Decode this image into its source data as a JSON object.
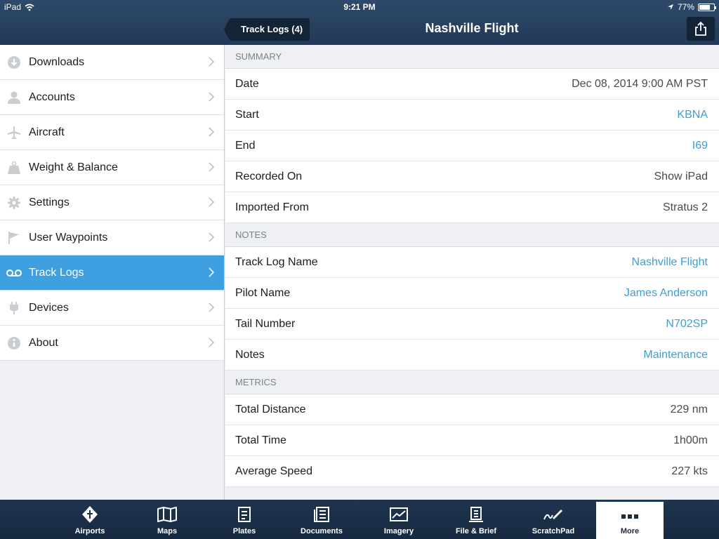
{
  "status": {
    "carrier": "iPad",
    "time": "9:21 PM",
    "battery": "77%",
    "battery_level": 0.77
  },
  "header": {
    "back_label": "Track Logs (4)",
    "title": "Nashville Flight"
  },
  "sidebar": {
    "items": [
      {
        "label": "Downloads",
        "icon": "download-icon"
      },
      {
        "label": "Accounts",
        "icon": "person-icon"
      },
      {
        "label": "Aircraft",
        "icon": "plane-icon"
      },
      {
        "label": "Weight & Balance",
        "icon": "weight-icon"
      },
      {
        "label": "Settings",
        "icon": "gear-icon"
      },
      {
        "label": "User Waypoints",
        "icon": "flag-icon"
      },
      {
        "label": "Track Logs",
        "icon": "voicemail-icon",
        "active": true
      },
      {
        "label": "Devices",
        "icon": "plug-icon"
      },
      {
        "label": "About",
        "icon": "info-icon"
      }
    ]
  },
  "summary": {
    "header": "SUMMARY",
    "rows": [
      {
        "label": "Date",
        "value": "Dec 08, 2014 9:00 AM PST"
      },
      {
        "label": "Start",
        "value": "KBNA"
      },
      {
        "label": "End",
        "value": "I69"
      },
      {
        "label": "Recorded On",
        "value": "Show iPad"
      },
      {
        "label": "Imported From",
        "value": "Stratus 2"
      }
    ]
  },
  "notes": {
    "header": "NOTES",
    "rows": [
      {
        "label": "Track Log Name",
        "value": "Nashville Flight"
      },
      {
        "label": "Pilot Name",
        "value": "James Anderson"
      },
      {
        "label": "Tail Number",
        "value": "N702SP"
      },
      {
        "label": "Notes",
        "value": "Maintenance"
      }
    ]
  },
  "metrics": {
    "header": "METRICS",
    "rows": [
      {
        "label": "Total Distance",
        "value": "229 nm"
      },
      {
        "label": "Total Time",
        "value": "1h00m"
      },
      {
        "label": "Average Speed",
        "value": "227 kts"
      }
    ]
  },
  "tabs": [
    {
      "label": "Airports",
      "icon": "airports-icon"
    },
    {
      "label": "Maps",
      "icon": "map-icon"
    },
    {
      "label": "Plates",
      "icon": "plates-icon"
    },
    {
      "label": "Documents",
      "icon": "documents-icon"
    },
    {
      "label": "Imagery",
      "icon": "imagery-icon"
    },
    {
      "label": "File & Brief",
      "icon": "file-brief-icon"
    },
    {
      "label": "ScratchPad",
      "icon": "scratchpad-icon"
    },
    {
      "label": "More",
      "icon": "more-icon",
      "active": true
    }
  ],
  "colors": {
    "accent": "#3ea0e0",
    "link": "#3a9fd8",
    "header_bg": "#2e4969"
  }
}
